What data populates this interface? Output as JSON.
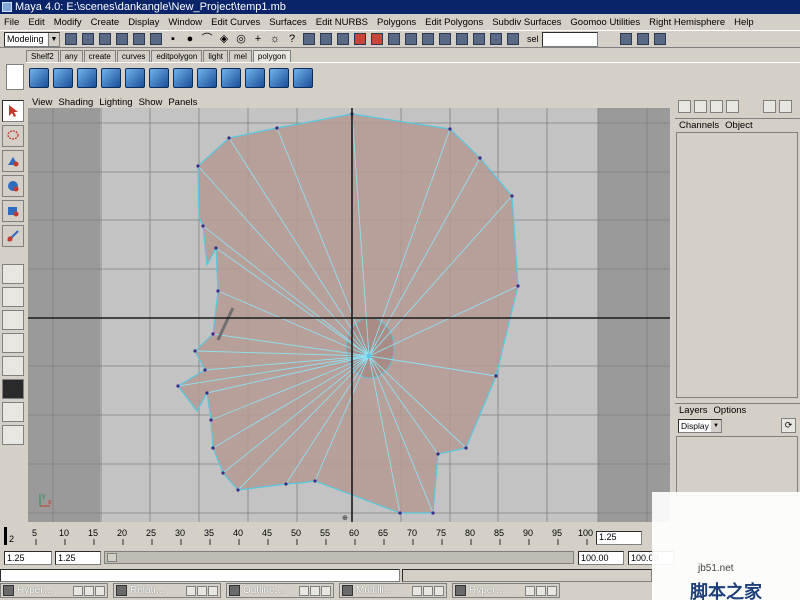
{
  "window": {
    "title": "Maya 4.0: E:\\scenes\\dankangle\\New_Project\\temp1.mb"
  },
  "menubar": {
    "items": [
      "File",
      "Edit",
      "Modify",
      "Create",
      "Display",
      "Window",
      "Edit Curves",
      "Surfaces",
      "Edit NURBS",
      "Polygons",
      "Edit Polygons",
      "Subdiv Surfaces",
      "Goomoo Utilities",
      "Right Hemisphere",
      "Help"
    ]
  },
  "statusline": {
    "mode": "Modeling",
    "sel_label": "sel"
  },
  "shelf": {
    "tabs": [
      "Shelf2",
      "any",
      "create",
      "curves",
      "editpolygon",
      "light",
      "mel",
      "polygon"
    ],
    "active_tab": "polygon"
  },
  "viewport": {
    "panel_menu": [
      "View",
      "Shading",
      "Lighting",
      "Show",
      "Panels"
    ],
    "axis": {
      "x_label": "x",
      "y_label": "y"
    }
  },
  "channel_box": {
    "menu": [
      "Channels",
      "Object"
    ]
  },
  "layers": {
    "menu": [
      "Layers",
      "Options"
    ],
    "mode": "Display"
  },
  "timeline": {
    "ticks": [
      "5",
      "10",
      "15",
      "20",
      "25",
      "30",
      "35",
      "40",
      "45",
      "50",
      "55",
      "60",
      "65",
      "70",
      "75",
      "80",
      "85",
      "90",
      "95",
      "100"
    ],
    "start_marker": "2",
    "current_time": "1.25"
  },
  "range": {
    "start": "1.25",
    "playback_start": "1.25",
    "playback_end": "100.00",
    "end": "100.00"
  },
  "taskbar": [
    "Hyper…",
    "Relati…",
    "Outline…",
    "Multilli…",
    "Hyper…"
  ],
  "watermark": {
    "url": "jb51.net",
    "cn": "脚本之家"
  }
}
